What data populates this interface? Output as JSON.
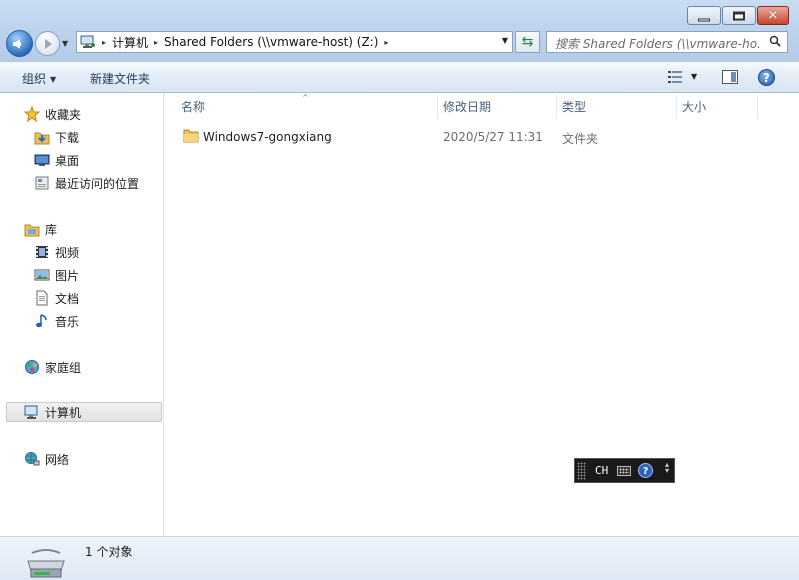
{
  "window": {
    "min_glyph": "",
    "max_glyph": "",
    "close_glyph": "✕"
  },
  "address_bar": {
    "crumbs": [
      "计算机",
      "Shared Folders (\\\\vmware-host) (Z:)"
    ],
    "separator": "▸"
  },
  "search": {
    "placeholder": "搜索 Shared Folders (\\\\vmware-ho..."
  },
  "toolbar": {
    "organize_label": "组织",
    "organize_arrow": "▼",
    "new_folder_label": "新建文件夹",
    "view_drop": "▼",
    "help_glyph": "?"
  },
  "sidebar": {
    "favorites": {
      "label": "收藏夹",
      "icon": "star-icon"
    },
    "favorites_items": [
      {
        "label": "下载",
        "icon": "download-folder-icon"
      },
      {
        "label": "桌面",
        "icon": "desktop-icon"
      },
      {
        "label": "最近访问的位置",
        "icon": "recent-places-icon"
      }
    ],
    "libraries": {
      "label": "库",
      "icon": "library-icon"
    },
    "library_items": [
      {
        "label": "视频",
        "icon": "video-icon"
      },
      {
        "label": "图片",
        "icon": "picture-icon"
      },
      {
        "label": "文档",
        "icon": "document-icon"
      },
      {
        "label": "音乐",
        "icon": "music-icon"
      }
    ],
    "homegroup": {
      "label": "家庭组",
      "icon": "homegroup-icon"
    },
    "computer": {
      "label": "计算机",
      "icon": "computer-icon"
    },
    "network": {
      "label": "网络",
      "icon": "network-icon"
    }
  },
  "columns": {
    "name": "名称",
    "modified": "修改日期",
    "type": "类型",
    "size": "大小",
    "sort_caret": "^"
  },
  "files": [
    {
      "name": "Windows7-gongxiang",
      "modified": "2020/5/27 11:31",
      "type": "文件夹",
      "size": ""
    }
  ],
  "ime": {
    "language": "CH",
    "help_glyph": "?",
    "menu_glyph": "▲\n▼"
  },
  "status": {
    "item_count": "1 个对象"
  },
  "colors": {
    "accent": "#1e395b",
    "titlebar": "#bcd3ee"
  }
}
